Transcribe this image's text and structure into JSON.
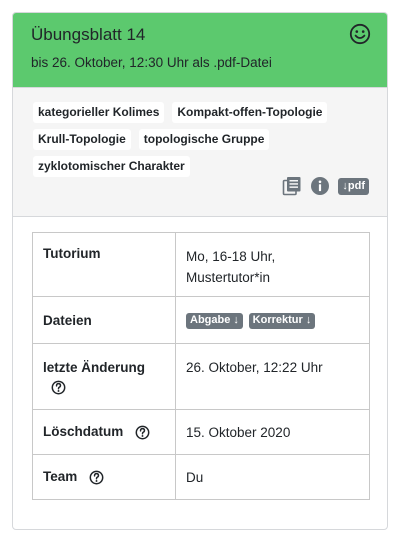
{
  "header": {
    "title": "Übungsblatt 14",
    "deadline": "bis 26. Oktober, 12:30 Uhr als .pdf-Datei",
    "status_icon": "smile-icon",
    "color": "#5cc96e"
  },
  "tags": [
    "kategorieller Kolimes",
    "Kompakt-offen-Topologie",
    "Krull-Topologie",
    "topologische Gruppe",
    "zyklotomischer Charakter"
  ],
  "tools": {
    "list_icon": "copy-list-icon",
    "info_icon": "info-icon",
    "pdf_label": "↓pdf"
  },
  "table": {
    "tutorium_label": "Tutorium",
    "tutorium_value": "Mo, 16-18 Uhr, Mustertutor*in",
    "dateien_label": "Dateien",
    "abgabe_label": "Abgabe ↓",
    "korrektur_label": "Korrektur ↓",
    "aenderung_label": "letzte Änderung",
    "aenderung_value": "26. Oktober, 12:22 Uhr",
    "loeschdatum_label": "Löschdatum",
    "loeschdatum_value": "15. Oktober 2020",
    "team_label": "Team",
    "team_value": "Du"
  }
}
